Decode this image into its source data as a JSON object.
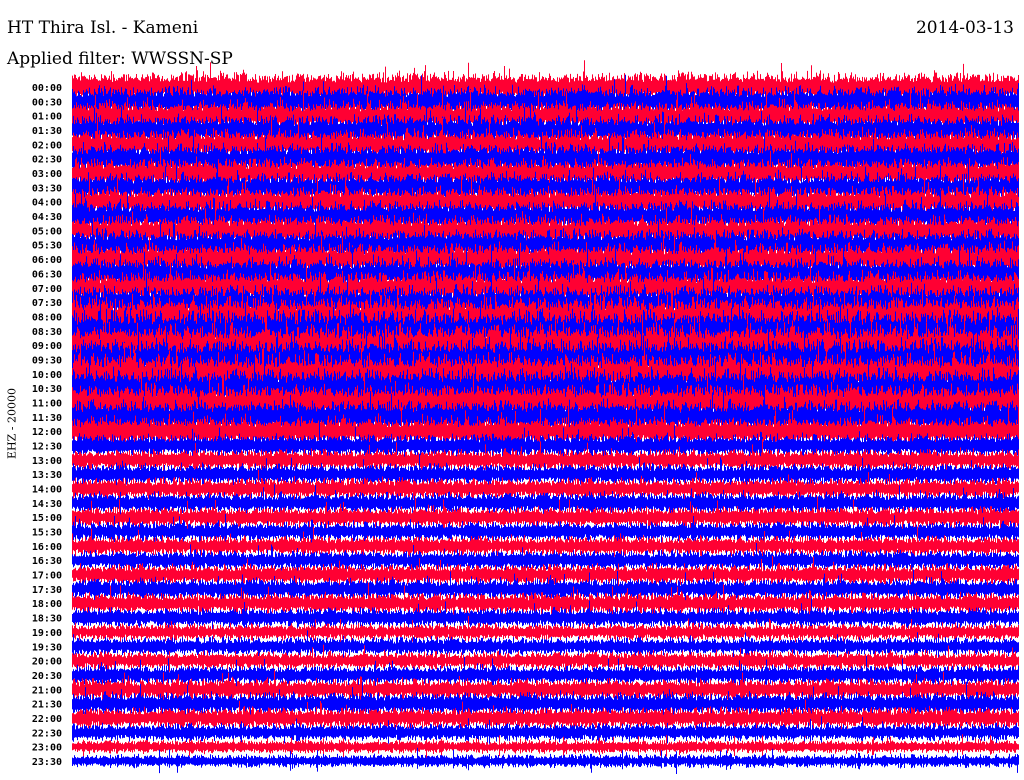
{
  "header": {
    "station": "HT Thira Isl. - Kameni",
    "date": "2014-03-13",
    "filter": "Applied filter: WWSSN-SP"
  },
  "chart_data": {
    "type": "line",
    "title": "HT Thira Isl. - Kameni",
    "subtitle": "Applied filter: WWSSN-SP",
    "ylabel": "EHZ - 20000",
    "xlabel": "",
    "colors": [
      "#ff0033",
      "#0000ff"
    ],
    "row_labels": [
      "00:00",
      "00:30",
      "01:00",
      "01:30",
      "02:00",
      "02:30",
      "03:00",
      "03:30",
      "04:00",
      "04:30",
      "05:00",
      "05:30",
      "06:00",
      "06:30",
      "07:00",
      "07:30",
      "08:00",
      "08:30",
      "09:00",
      "09:30",
      "10:00",
      "10:30",
      "11:00",
      "11:30",
      "12:00",
      "12:30",
      "13:00",
      "13:30",
      "14:00",
      "14:30",
      "15:00",
      "15:30",
      "16:00",
      "16:30",
      "17:00",
      "17:30",
      "18:00",
      "18:30",
      "19:00",
      "19:30",
      "20:00",
      "20:30",
      "21:00",
      "21:30",
      "22:00",
      "22:30",
      "23:00",
      "23:30"
    ],
    "relative_amplitude": [
      1.0,
      1.0,
      1.0,
      1.0,
      1.0,
      1.0,
      0.95,
      0.95,
      1.0,
      1.0,
      1.0,
      1.0,
      1.05,
      1.05,
      1.1,
      1.1,
      1.35,
      1.4,
      1.4,
      1.4,
      1.35,
      1.3,
      1.2,
      1.1,
      0.95,
      0.75,
      0.7,
      0.7,
      0.7,
      0.7,
      0.7,
      0.65,
      0.65,
      0.65,
      0.7,
      0.7,
      0.7,
      0.65,
      0.55,
      0.6,
      0.6,
      0.65,
      0.7,
      0.75,
      0.7,
      0.6,
      0.45,
      0.45
    ]
  }
}
